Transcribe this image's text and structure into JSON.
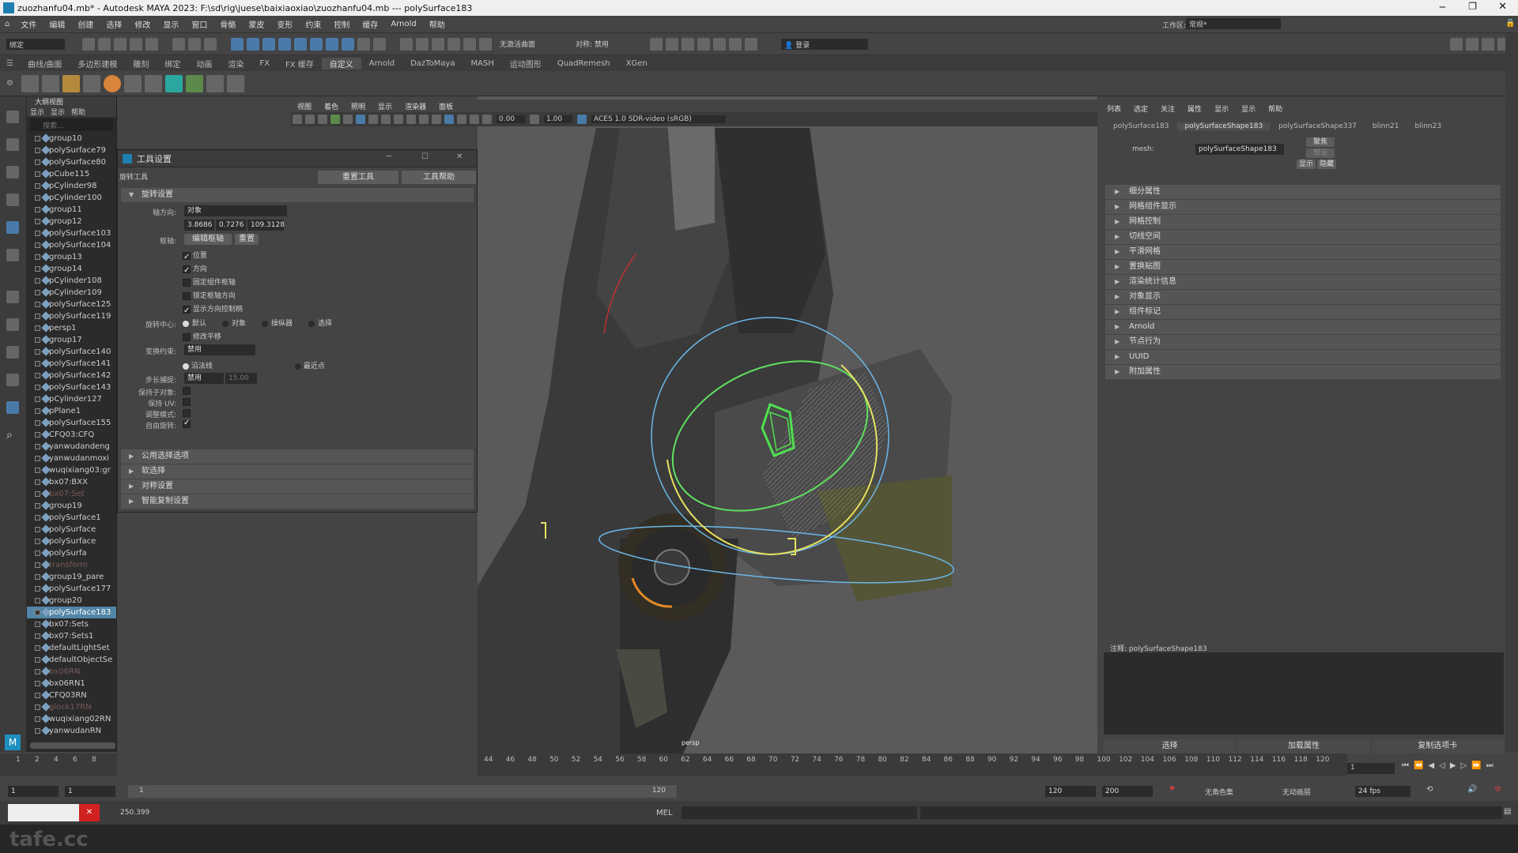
{
  "titlebar": {
    "title": "zuozhanfu04.mb* - Autodesk MAYA 2023: F:\\sd\\rig\\juese\\baixiaoxiao\\zuozhanfu04.mb  ---  polySurface183"
  },
  "menubar": {
    "items": [
      "文件",
      "编辑",
      "创建",
      "选择",
      "修改",
      "显示",
      "窗口",
      "骨骼",
      "蒙皮",
      "变形",
      "约束",
      "控制",
      "缓存",
      "Arnold",
      "帮助"
    ],
    "workspace_label": "工作区:",
    "workspace_value": "常规*"
  },
  "statusline": {
    "mode": "绑定",
    "no_live": "无激活曲面",
    "symmetry": "对称: 禁用",
    "login": "登录"
  },
  "shelf": {
    "tabs": [
      "曲线/曲面",
      "多边形建模",
      "雕刻",
      "绑定",
      "动画",
      "渲染",
      "FX",
      "FX 缓存",
      "自定义",
      "Arnold",
      "DazToMaya",
      "MASH",
      "运动图形",
      "QuadRemesh",
      "XGen"
    ],
    "active_tab": "自定义"
  },
  "outliner": {
    "title": "大纲视图",
    "menu": [
      "显示",
      "显示",
      "帮助"
    ],
    "search_placeholder": "搜索...",
    "items": [
      {
        "name": "group10"
      },
      {
        "name": "polySurface79"
      },
      {
        "name": "polySurface80"
      },
      {
        "name": "pCube115"
      },
      {
        "name": "pCylinder98"
      },
      {
        "name": "pCylinder100"
      },
      {
        "name": "group11"
      },
      {
        "name": "group12"
      },
      {
        "name": "polySurface103"
      },
      {
        "name": "polySurface104"
      },
      {
        "name": "group13"
      },
      {
        "name": "group14"
      },
      {
        "name": "pCylinder108"
      },
      {
        "name": "pCylinder109"
      },
      {
        "name": "polySurface125"
      },
      {
        "name": "polySurface119"
      },
      {
        "name": "persp1"
      },
      {
        "name": "group17"
      },
      {
        "name": "polySurface140"
      },
      {
        "name": "polySurface141"
      },
      {
        "name": "polySurface142"
      },
      {
        "name": "polySurface143"
      },
      {
        "name": "pCylinder127"
      },
      {
        "name": "pPlane1"
      },
      {
        "name": "polySurface155"
      },
      {
        "name": "CFQ03:CFQ"
      },
      {
        "name": "yanwudandeng"
      },
      {
        "name": "yanwudanmoxi"
      },
      {
        "name": "wuqixiang03:gr"
      },
      {
        "name": "bx07:BXX"
      },
      {
        "name": "bx07:Set"
      },
      {
        "name": "group19"
      },
      {
        "name": "polySurface1"
      },
      {
        "name": "polySurface"
      },
      {
        "name": "polySurface"
      },
      {
        "name": "polySurfa"
      },
      {
        "name": "transform"
      },
      {
        "name": "group19_pare"
      },
      {
        "name": "polySurface177"
      },
      {
        "name": "group20"
      },
      {
        "name": "polySurface183"
      },
      {
        "name": "bx07:Sets"
      },
      {
        "name": "bx07:Sets1"
      },
      {
        "name": "defaultLightSet"
      },
      {
        "name": "defaultObjectSe"
      },
      {
        "name": "bx06RN"
      },
      {
        "name": "bx06RN1"
      },
      {
        "name": "CFQ03RN"
      },
      {
        "name": "glock17RN"
      },
      {
        "name": "wuqixiang02RN"
      },
      {
        "name": "yanwudanRN"
      }
    ],
    "selected": "polySurface183"
  },
  "tool_settings": {
    "window_title": "工具设置",
    "tool_name": "旋转工具",
    "reset_btn": "重置工具",
    "help_btn": "工具帮助",
    "section_rotate": "旋转设置",
    "axis_label": "轴方向:",
    "axis_value": "对象",
    "axis_x": "3.8686",
    "axis_y": "0.7276",
    "axis_z": "109.3128",
    "pivot_label": "枢轴:",
    "pivot_edit": "编辑枢轴",
    "pivot_reset": "重置",
    "chk_position": "位置",
    "chk_orient": "方向",
    "chk_fixed": "固定组件枢轴",
    "chk_pin": "锁定枢轴方向",
    "chk_show": "显示方向控制柄",
    "center_label": "旋转中心:",
    "center_opts": [
      "默认",
      "对象",
      "操纵器",
      "选择"
    ],
    "chk_modify": "修改平移",
    "constraint_label": "变换约束:",
    "constraint_value": "禁用",
    "normal_opt": "沿法线",
    "closest_opt": "最近点",
    "step_label": "步长捕捉:",
    "step_value": "禁用",
    "step_num": "15.00",
    "keep_children": "保持子对象:",
    "keep_uv": "保持 UV:",
    "tweak": "调整模式:",
    "discrete": "自由旋转:",
    "sections": [
      "公用选择选项",
      "软选择",
      "对称设置",
      "智能复制设置"
    ]
  },
  "viewport": {
    "menu": [
      "视图",
      "着色",
      "照明",
      "显示",
      "渲染器",
      "面板"
    ],
    "val1": "0.00",
    "val2": "1.00",
    "colorspace": "ACES 1.0 SDR-video (sRGB)",
    "camera": "persp"
  },
  "attr_editor": {
    "menu": [
      "列表",
      "选定",
      "关注",
      "属性",
      "显示",
      "显示",
      "帮助"
    ],
    "tabs": [
      "polySurface183",
      "polySurfaceShape183",
      "polySurfaceShape337",
      "blinn21",
      "blinn23"
    ],
    "active_tab": "polySurfaceShape183",
    "mesh_label": "mesh:",
    "mesh_value": "polySurfaceShape183",
    "focus_btn": "聚焦",
    "preset_btn": "预设",
    "show_btn": "显示",
    "hide_btn": "隐藏",
    "sections": [
      "细分属性",
      "网格组件显示",
      "网格控制",
      "切线空间",
      "平滑网格",
      "置换贴图",
      "渲染统计信息",
      "对象显示",
      "组件标记",
      "Arnold",
      "节点行为",
      "UUID",
      "附加属性"
    ],
    "notes_label": "注释: polySurfaceShape183",
    "btn_select": "选择",
    "btn_load": "加载属性",
    "btn_copy": "复制选项卡"
  },
  "timeline": {
    "ticks": [
      "44",
      "46",
      "48",
      "50",
      "52",
      "54",
      "56",
      "58",
      "60",
      "62",
      "64",
      "66",
      "68",
      "70",
      "72",
      "74",
      "76",
      "78",
      "80",
      "82",
      "84",
      "86",
      "88",
      "90",
      "92",
      "94",
      "96",
      "98",
      "100",
      "102",
      "104",
      "106",
      "108",
      "110",
      "112",
      "114",
      "116",
      "118",
      "120"
    ],
    "left_ticks": [
      "1",
      "2",
      "4",
      "6",
      "8"
    ],
    "current_frame": "1"
  },
  "rangebar": {
    "start": "1",
    "start2": "1",
    "range_start": "1",
    "range_end": "120",
    "end1": "120",
    "end2": "200",
    "char_set": "无角色集",
    "anim_layer": "无动画层",
    "fps": "24 fps"
  },
  "cmdline": {
    "mel": "MEL",
    "value": "250.399"
  },
  "watermark": "tafe.cc"
}
